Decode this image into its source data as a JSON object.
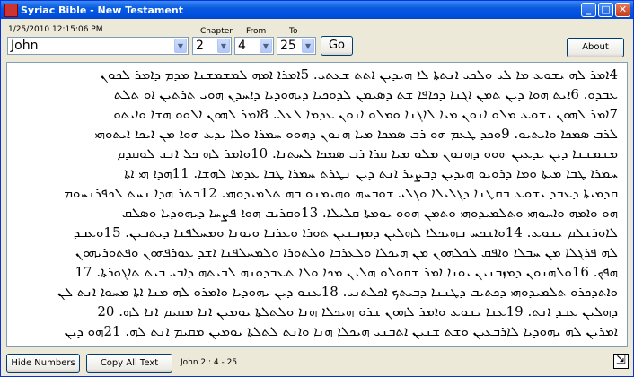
{
  "window": {
    "title": "Syriac Bible - New Testament",
    "minimize": "_",
    "maximize": "□",
    "close": "✕"
  },
  "timestamp": "1/25/2010 12:15:06 PM",
  "selectors": {
    "book": "John",
    "chapter_label": "Chapter",
    "chapter": "2",
    "from_label": "From",
    "from": "4",
    "to_label": "To",
    "to": "25"
  },
  "buttons": {
    "go": "Go",
    "about": "About",
    "hide_numbers": "Hide Numbers",
    "copy_all": "Copy All Text"
  },
  "status": "John 2 : 4 - 25",
  "verses_text": [
    "4ܐܡܪ ܠܗ ܝܫܘܥ ܡܐ ܠܝ ܘܠܟܝ ܐܢܬܬܐ ܠܐ ܗܝܕܝܢ ܐܬܬ ܫܥܬܝ. 5ܐܡܪܐ ܐܡܗ ܠܡܫܡܫܢܐ ܡܕܡ ܕܐܡܪ ܠܟܘܢ",
    "ܥܒܕܘ. 6ܐܝܬ ܗܘܐ ܕܝܢ ܬܡܢ ܐܓܢܐ ܕܟܐܦܐ ܫܬ ܕܤܝܡܢ ܠܕܘܟܝܐ ܕܝܗܘܕܝܐ ܕܐܚܕܢ ܗܘܝ ܬܪܬܝܢ ܐܘ ܬܠܬ",
    "7ܐܡܪ ܠܗܘܢ ܝܫܘܥ ܡܠܘ ܐܢܘܢ ܡܝܐ ܠܐܓܢܐ ܘܡܠܘ ܐܢܘܢ ܥܕܡܐ ܠܥܠ. 8ܐܡܪ ܠܗܘܢ ܐܠܘܘ ܗܫܐ ܘܐܝܬܘ",
    "ܠܪܒ ܤܡܟܐ ܘܐܝܬܝܘ. 9ܘܟܕ ܛܥܡ ܗܘ ܪܒ ܤܡܟܐ ܡܝܐ ܗܢܘܢ ܕܗܘܘ ܚܡܪܐ ܘܠܐ ܝܕܥ ܗܘܐ ܡܢ ܐܝܟܐ ܐܝܬܘܗܝ",
    "ܡܫܡܫܢܐ ܕܝܢ ܝܕܥܝܢ ܗܘܘ ܕܗܢܘܢ ܡܠܘ ܡܝܐ ܩܪܐ ܪܒ ܤܡܟܐ ܠܚܬܢܐ. 10ܘܐܡܪ ܠܗ ܟܠ ܐܢܫ ܠܘܩܕܡ",
    "ܚܡܪܐ ܛܒܐ ܡܝܬܐ ܘܡܐ ܕܪܘܝܘ ܗܝܕܝܢ ܕܒܨܝܪ ܐܢܬ ܕܝܢ ܢܛܪܬ ܚܡܪܐ ܛܒܐ ܥܕܡܐ ܠܗܫܐ. 11ܗܕܐ ܗܝ ܐܬܐ",
    "ܩܕܡܝܬܐ ܕܥܒܕ ܝܫܘܥ ܒܩܛܢܐ ܕܓܠܝܠܐ ܘܓܠܝ ܫܘܒܚܗ ܘܗܝܡܢܘ ܒܗ ܬܠܡܝܕܘܗܝ. 12ܒܬܪ ܗܕܐ ܢܚܬ ܠܟܦܪܢܚܘܡ",
    "ܗܘ ܘܐܡܗ ܘܐܚܘܗܝ ܘܬܠܡܝܕܘܗܝ ܘܬܡܢ ܗܘܘ ܝܘܡܬܐ ܩܠܝܠܐ. 13ܘܩܪܝܒ ܗܘܐ ܦܨܚܐ ܕܝܗܘܕܝܐ ܘܤܠܩ",
    "ܠܐܘܪܫܠܡ ܝܫܘܥ. 14ܘܐܫܟܚ ܒܗܝܟܠܐ ܠܗܠܝܢ ܕܡܙܒܢܝܢ ܬܘܪܐ ܘܥܪܒܐ ܘܝܘܢܐ ܘܡܚܠܦܢܐ ܕܝܬܒܝܢ. 15ܘܥܒܕ",
    "ܠܗ ܦܪܓܠܐ ܡܢ ܚܒܠܐ ܘܐܦܩ ܠܟܠܗܘܢ ܡܢ ܗܝܟܠܐ ܘܠܥܪܒܐ ܘܠܬܘܪܐ ܘܠܡܚܠܦܢܐ ܐܫܕ ܥܘܪܦܗܘܢ ܘܦܬܘܪܝܗܘܢ",
    "ܗܦܟ. 16ܘܠܗܢܘܢ ܕܡܙܒܢܝܢ ܝܘܢܐ ܐܡܪ ܫܩܘܠܘ ܗܠܝܢ ܡܟܐ ܘܠܐ ܬܥܒܕܘܢܗ ܠܒܝܬܗ ܕܐܒܝ ܒܝܬ ܬܐܓܘܪܬܐ. 17",
    "ܘܐܬܕܟܪܘ ܬܠܡܝܕܘܗܝ ܕܟܬܝܒ ܕܛܢܢܐ ܕܒܝܬܟ ܐܟܠܬܢܝ. 18ܥܢܘ ܕܝܢ ܝܗܘܕܝܐ ܘܐܡܪܘ ܠܗ ܡܢܐ ܐܬܐ ܡܚܘܐ ܐܢܬ ܠܢ",
    "ܕܗܠܝܢ ܥܒܕ ܐܢܬ. 19ܥܢܐ ܝܫܘܥ ܘܐܡܪ ܠܗܘܢ ܫܪܘ ܗܝܟܠܐ ܗܢܐ ܘܠܬܠܬܐ ܝܘܡܝܢ ܐܢܐ ܡܩܝܡ ܐܢܐ ܠܗ. 20",
    "ܐܡܪܝܢ ܠܗ ܝܗܘܕܝܐ ܠܐܪܒܥܝܢ ܘܫܬ ܫܢܝܢ ܐܬܒܢܝ ܗܝܟܠܐ ܗܢܐ ܘܐܢܬ ܠܬܠܬܐ ܝܘܡܝܢ ܡܩܝܡ ܐܢܬ ܠܗ. 21ܗܘ ܕܝܢ"
  ]
}
